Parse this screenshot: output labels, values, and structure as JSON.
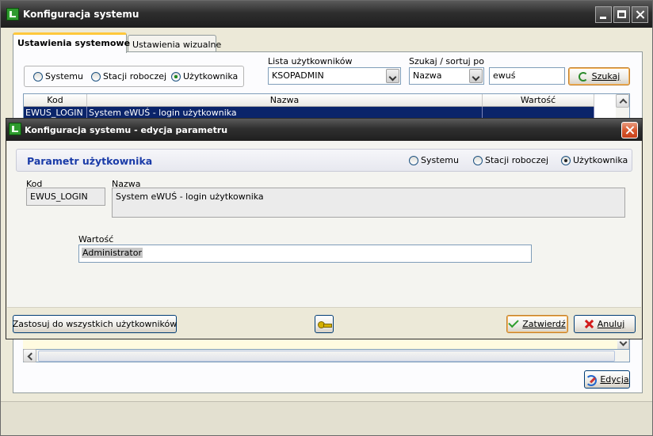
{
  "window": {
    "title": "Konfiguracja systemu"
  },
  "tabs": [
    {
      "label": "Ustawienia systemowe",
      "active": true
    },
    {
      "label": "Ustawienia wizualne",
      "active": false
    }
  ],
  "filter": {
    "scope_options": [
      "Systemu",
      "Stacji roboczej",
      "Użytkownika"
    ],
    "scope_selected": "Użytkownika",
    "user_list_label": "Lista użytkowników",
    "user_list_value": "KSOPADMIN",
    "sort_label": "Szukaj / sortuj po",
    "sort_value": "Nazwa",
    "search_value": "ewuś",
    "search_button": "Szukaj"
  },
  "grid": {
    "columns": [
      "Kod",
      "Nazwa",
      "Wartość"
    ],
    "selected_row": {
      "kod": "EWUS_LOGIN",
      "nazwa": "System eWUŚ - login użytkownika",
      "wartosc": ""
    }
  },
  "edit_button": "Edycja",
  "dialog": {
    "title": "Konfiguracja systemu - edycja parametru",
    "header_title": "Parametr użytkownika",
    "scope_options": [
      "Systemu",
      "Stacji roboczej",
      "Użytkownika"
    ],
    "scope_selected": "Użytkownika",
    "kod_label": "Kod",
    "kod_value": "EWUS_LOGIN",
    "nazwa_label": "Nazwa",
    "nazwa_value": "System eWUŚ - login użytkownika",
    "wartosc_label": "Wartość",
    "wartosc_value": "Administrator",
    "apply_all_button": "Zastosuj do wszystkich użytkowników",
    "confirm_button": "Zatwierdź",
    "cancel_button": "Anuluj"
  },
  "colors": {
    "selection": "#0a246a",
    "dialog_header_text": "#1a3ba8",
    "close_button": "#d85a30"
  }
}
